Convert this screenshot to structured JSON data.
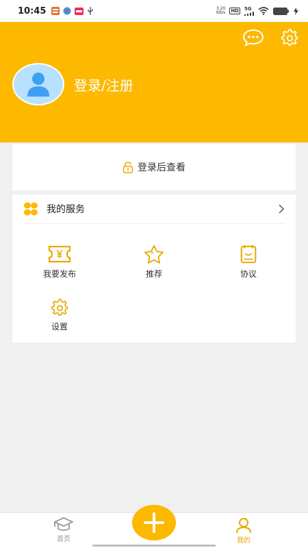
{
  "status_bar": {
    "time": "10:45",
    "net_speed_value": "3.20",
    "net_speed_unit": "KB/s",
    "hd": "HD",
    "network": "5G"
  },
  "header": {
    "login_register": "登录/注册"
  },
  "login_card": {
    "text": "登录后查看"
  },
  "services": {
    "title": "我的服务",
    "items": [
      {
        "label": "我要发布",
        "icon": "ticket-yen-icon"
      },
      {
        "label": "推荐",
        "icon": "star-icon"
      },
      {
        "label": "协议",
        "icon": "notebook-icon"
      },
      {
        "label": "设置",
        "icon": "gear-icon"
      }
    ]
  },
  "tabbar": {
    "home": "首页",
    "mine": "我的"
  },
  "colors": {
    "accent": "#fcb900",
    "icon_gold": "#e8a800",
    "avatar_bg": "#b8e1ff",
    "avatar_figure": "#3ea0f0",
    "inactive_tab": "#999999"
  }
}
